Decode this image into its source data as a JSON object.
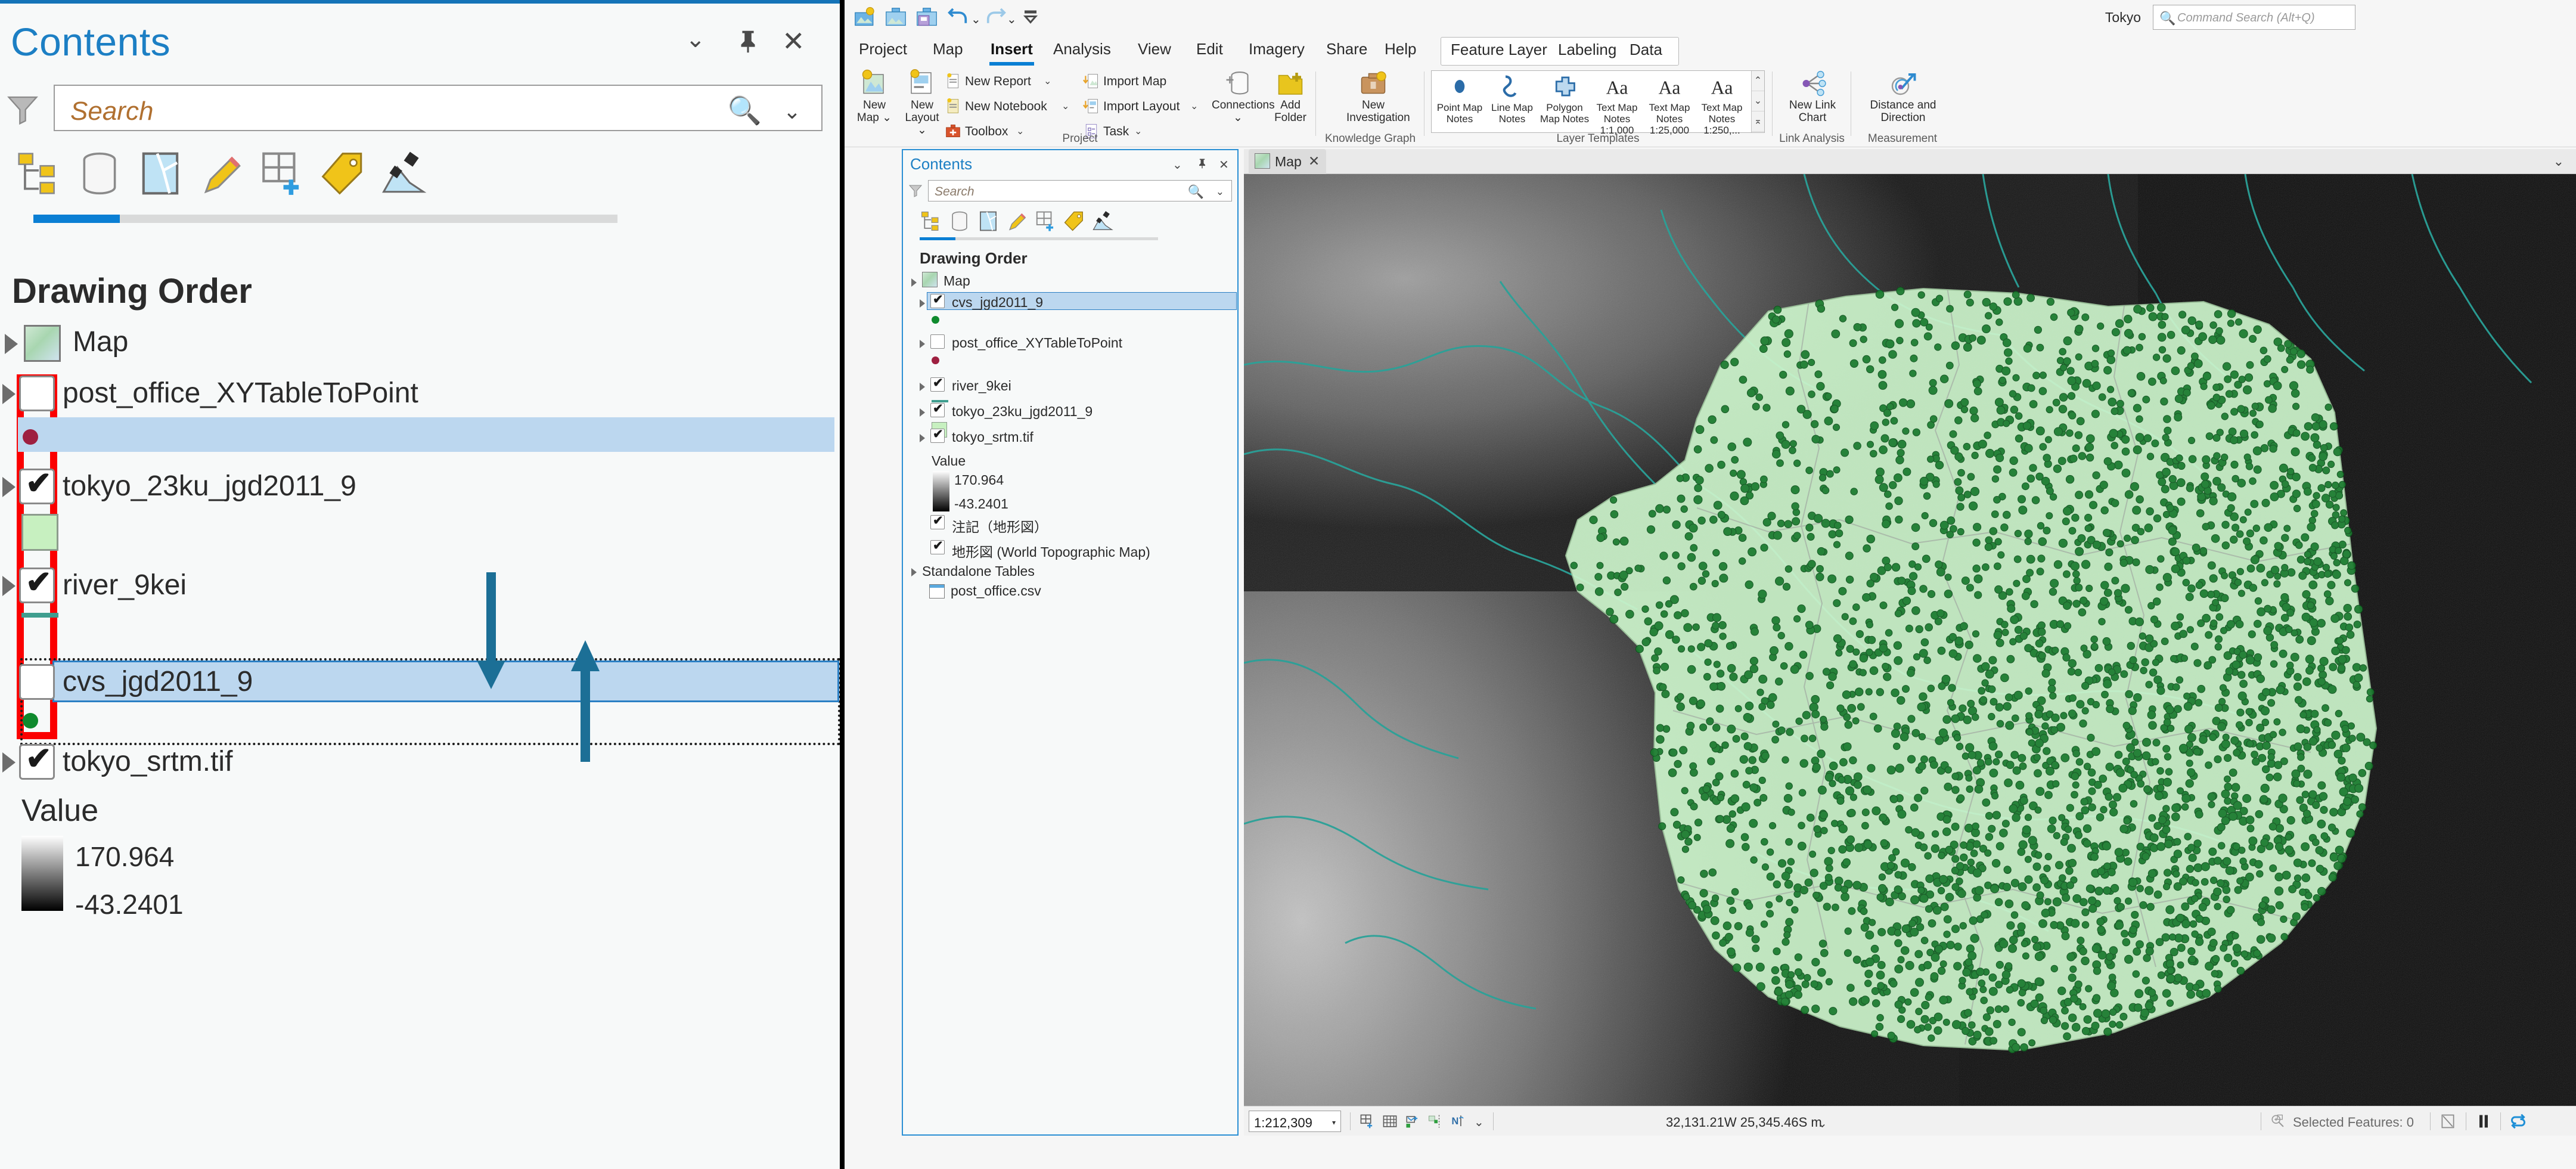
{
  "magnified": {
    "title": "Contents",
    "window_buttons": {
      "chevron": "⌄",
      "pin": "⊼",
      "close": "✕"
    },
    "search_placeholder": "Search",
    "drawing_order_label": "Drawing Order",
    "map_label": "Map",
    "layers": [
      {
        "name": "post_office_XYTableToPoint",
        "checked": false,
        "symbol": "point",
        "symbol_color": "#9e2040"
      },
      {
        "name": "tokyo_23ku_jgd2011_9",
        "checked": true,
        "symbol": "polygon",
        "symbol_color": "#c7f0c0"
      },
      {
        "name": "river_9kei",
        "checked": true,
        "symbol": "line",
        "symbol_color": "#3f9e8f"
      },
      {
        "name": "cvs_jgd2011_9",
        "checked": false,
        "symbol": "point",
        "symbol_color": "#0f8a2e"
      },
      {
        "name": "tokyo_srtm.tif",
        "checked": true,
        "symbol": "raster",
        "symbol_color": "#888888"
      }
    ],
    "raster_legend": {
      "heading": "Value",
      "max": "170.964",
      "min": "-43.2401"
    },
    "annotations": {
      "down_arrow": "move-layer-down-arrow",
      "up_arrow": "move-layer-up-arrow",
      "highlight": "checkbox-column-highlight"
    }
  },
  "app": {
    "project_name": "Tokyo",
    "command_search_placeholder": "Command Search (Alt+Q)",
    "quick_access": [
      {
        "name": "new-project-icon"
      },
      {
        "name": "open-project-icon"
      },
      {
        "name": "save-project-icon"
      },
      {
        "name": "undo-icon"
      },
      {
        "name": "redo-icon"
      },
      {
        "name": "customize-qat-icon"
      }
    ],
    "tabs": [
      {
        "label": "Project",
        "active": false
      },
      {
        "label": "Map",
        "active": false
      },
      {
        "label": "Insert",
        "active": true
      },
      {
        "label": "Analysis",
        "active": false
      },
      {
        "label": "View",
        "active": false
      },
      {
        "label": "Edit",
        "active": false
      },
      {
        "label": "Imagery",
        "active": false
      },
      {
        "label": "Share",
        "active": false
      },
      {
        "label": "Help",
        "active": false
      }
    ],
    "contextual_tabs": [
      {
        "label": "Feature Layer"
      },
      {
        "label": "Labeling"
      },
      {
        "label": "Data"
      }
    ],
    "ribbon_groups": [
      {
        "title": "Project",
        "big_buttons": [
          {
            "label_line1": "New",
            "label_line2": "Map ⌄",
            "icon": "new-map-icon"
          },
          {
            "label_line1": "New",
            "label_line2": "Layout ⌄",
            "icon": "new-layout-icon"
          }
        ],
        "small_buttons": [
          {
            "label": "New Report",
            "icon": "new-report-icon",
            "has_chevron": true
          },
          {
            "label": "New Notebook",
            "icon": "new-notebook-icon",
            "has_chevron": true
          },
          {
            "label": "Toolbox",
            "icon": "toolbox-icon",
            "has_chevron": true
          },
          {
            "label": "Import Map",
            "icon": "import-map-icon",
            "has_chevron": false
          },
          {
            "label": "Import Layout",
            "icon": "import-layout-icon",
            "has_chevron": true
          },
          {
            "label": "Task",
            "icon": "task-icon",
            "has_chevron": true
          }
        ],
        "extra_big": [
          {
            "label_line1": "Connections",
            "label_line2": "⌄",
            "icon": "connections-icon"
          },
          {
            "label_line1": "Add",
            "label_line2": "Folder",
            "icon": "add-folder-icon"
          }
        ]
      },
      {
        "title": "Knowledge Graph",
        "big_buttons": [
          {
            "label_line1": "New",
            "label_line2": "Investigation",
            "icon": "new-investigation-icon"
          }
        ]
      },
      {
        "title": "Layer Templates",
        "gallery": [
          {
            "label_line1": "Point Map",
            "label_line2": "Notes",
            "icon": "point-symbol-icon"
          },
          {
            "label_line1": "Line Map",
            "label_line2": "Notes",
            "icon": "line-symbol-icon"
          },
          {
            "label_line1": "Polygon",
            "label_line2": "Map Notes",
            "icon": "polygon-symbol-icon"
          },
          {
            "label_line1": "Text Map",
            "label_line2": "Notes 1:1,000",
            "icon": "text-symbol-icon"
          },
          {
            "label_line1": "Text Map",
            "label_line2": "Notes 1:25,000",
            "icon": "text-symbol-icon"
          },
          {
            "label_line1": "Text Map",
            "label_line2": "Notes 1:250,...",
            "icon": "text-symbol-icon"
          }
        ]
      },
      {
        "title": "Link Analysis",
        "big_buttons": [
          {
            "label_line1": "New Link",
            "label_line2": "Chart",
            "icon": "link-chart-icon"
          }
        ]
      },
      {
        "title": "Measurement",
        "big_buttons": [
          {
            "label_line1": "Distance and",
            "label_line2": "Direction",
            "icon": "distance-direction-icon"
          }
        ]
      }
    ]
  },
  "contents_pane": {
    "title": "Contents",
    "window_buttons": {
      "chevron": "⌄",
      "pin": "⊼",
      "close": "✕"
    },
    "search_placeholder": "Search",
    "drawing_order_label": "Drawing Order",
    "map_label": "Map",
    "toolbar_icons": [
      "list-by-drawing-order-icon",
      "list-by-data-source-icon",
      "list-by-selection-icon",
      "list-by-editing-icon",
      "list-by-snapping-icon",
      "list-by-labeling-icon",
      "list-by-diagrams-icon"
    ],
    "items": [
      {
        "name": "cvs_jgd2011_9",
        "checked": true,
        "selected": true,
        "symbol": "point",
        "symbol_color": "#0f8a2e",
        "indent": 1
      },
      {
        "name": "post_office_XYTableToPoint",
        "checked": false,
        "selected": false,
        "symbol": "point",
        "symbol_color": "#9e2040",
        "indent": 1
      },
      {
        "name": "river_9kei",
        "checked": true,
        "selected": false,
        "symbol": "line",
        "symbol_color": "#3f9e8f",
        "indent": 1
      },
      {
        "name": "tokyo_23ku_jgd2011_9",
        "checked": true,
        "selected": false,
        "symbol": "polygon",
        "symbol_color": "#c7f0c0",
        "indent": 1
      },
      {
        "name": "tokyo_srtm.tif",
        "checked": true,
        "selected": false,
        "symbol": "raster",
        "indent": 1
      }
    ],
    "raster_legend": {
      "heading": "Value",
      "max": "170.964",
      "min": "-43.2401"
    },
    "basemap_layers": [
      {
        "name": "注記（地形図）",
        "checked": true
      },
      {
        "name": "地形図 (World Topographic Map)",
        "checked": true
      }
    ],
    "standalone_tables_label": "Standalone Tables",
    "standalone_tables": [
      {
        "name": "post_office.csv"
      }
    ]
  },
  "mapview": {
    "tab_label": "Map",
    "tab_close": "✕",
    "collapse_chevron": "⌄"
  },
  "statusbar": {
    "scale": "1:212,309",
    "scale_dropdown_arrow": "▾",
    "tools": [
      "add-data-icon",
      "grid-icon",
      "explore-icon",
      "snapping-icon",
      "north-arrow-icon"
    ],
    "tools_chevron": "⌄",
    "coordinates": "32,131.21W 25,345.46S m",
    "coordinates_chevron": "⌄",
    "selected_features_label": "Selected Features: 0",
    "right_icons": [
      "clear-selection-icon",
      "pause-drawing-icon",
      "refresh-icon"
    ]
  }
}
